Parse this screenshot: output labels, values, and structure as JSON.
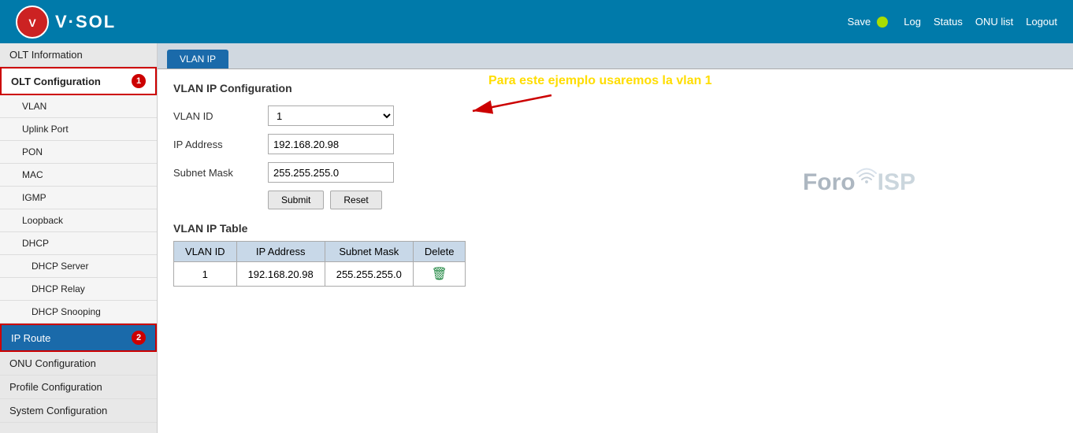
{
  "header": {
    "logo_text": "V·SOL",
    "save_label": "Save",
    "save_dot_color": "#aadd00",
    "nav": {
      "log": "Log",
      "status": "Status",
      "onu_list": "ONU list",
      "logout": "Logout"
    }
  },
  "sidebar": {
    "items": [
      {
        "id": "olt-info",
        "label": "OLT Information",
        "type": "top",
        "active": false,
        "badge": null
      },
      {
        "id": "olt-config",
        "label": "OLT Configuration",
        "type": "top",
        "active": true,
        "badge": "1"
      },
      {
        "id": "vlan",
        "label": "VLAN",
        "type": "sub"
      },
      {
        "id": "uplink-port",
        "label": "Uplink Port",
        "type": "sub"
      },
      {
        "id": "pon",
        "label": "PON",
        "type": "sub"
      },
      {
        "id": "mac",
        "label": "MAC",
        "type": "sub"
      },
      {
        "id": "igmp",
        "label": "IGMP",
        "type": "sub"
      },
      {
        "id": "loopback",
        "label": "Loopback",
        "type": "sub"
      },
      {
        "id": "dhcp",
        "label": "DHCP",
        "type": "sub"
      },
      {
        "id": "dhcp-server",
        "label": "DHCP Server",
        "type": "subsub"
      },
      {
        "id": "dhcp-relay",
        "label": "DHCP Relay",
        "type": "subsub"
      },
      {
        "id": "dhcp-snooping",
        "label": "DHCP Snooping",
        "type": "subsub"
      },
      {
        "id": "ip-route",
        "label": "IP Route",
        "type": "sub",
        "active": true,
        "badge": "2"
      },
      {
        "id": "onu-config",
        "label": "ONU Configuration",
        "type": "top"
      },
      {
        "id": "profile-config",
        "label": "Profile Configuration",
        "type": "top"
      },
      {
        "id": "system-config",
        "label": "System Configuration",
        "type": "top"
      }
    ]
  },
  "tab": {
    "label": "VLAN IP"
  },
  "content": {
    "section_title": "VLAN IP Configuration",
    "annotation": "Para este ejemplo usaremos la vlan 1",
    "form": {
      "vlan_id_label": "VLAN ID",
      "vlan_id_value": "1",
      "ip_address_label": "IP Address",
      "ip_address_value": "192.168.20.98",
      "subnet_mask_label": "Subnet Mask",
      "subnet_mask_value": "255.255.255.0",
      "submit_label": "Submit",
      "reset_label": "Reset"
    },
    "table": {
      "title": "VLAN IP Table",
      "columns": [
        "VLAN ID",
        "IP Address",
        "Subnet Mask",
        "Delete"
      ],
      "rows": [
        {
          "vlan_id": "1",
          "ip_address": "192.168.20.98",
          "subnet_mask": "255.255.255.0"
        }
      ]
    }
  },
  "watermark": {
    "foro": "Foro",
    "isp": "ISP"
  }
}
